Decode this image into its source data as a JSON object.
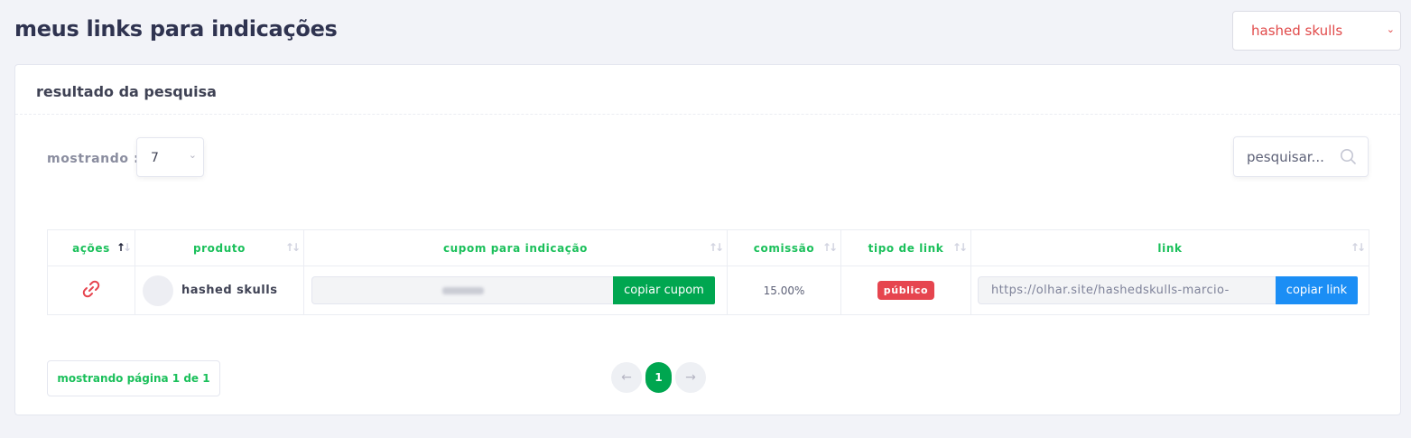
{
  "page": {
    "title": "meus links para indicações"
  },
  "product_select": {
    "value": "hashed skulls"
  },
  "card": {
    "title": "resultado da pesquisa"
  },
  "length": {
    "label": "mostrando :",
    "value": "7"
  },
  "search": {
    "placeholder": "pesquisar..."
  },
  "table": {
    "headers": [
      "ações",
      "produto",
      "cupom para indicação",
      "comissão",
      "tipo de link",
      "link"
    ],
    "rows": [
      {
        "produto": "hashed skulls",
        "cupom_button": "copiar cupom",
        "comissao": "15.00%",
        "tipo": "público",
        "link": "https://olhar.site/hashedskulls-marcio-",
        "link_button": "copiar link"
      }
    ]
  },
  "pagination": {
    "info": "mostrando página 1 de 1",
    "current": "1"
  },
  "colors": {
    "accent_green": "#00a650",
    "header_green": "#1bc05b",
    "badge_red": "#e6454f",
    "link_blue": "#1b8ef5"
  },
  "icons": {
    "actions": "link-icon",
    "search": "search-icon",
    "prev": "arrow-left-icon",
    "next": "arrow-right-icon"
  }
}
